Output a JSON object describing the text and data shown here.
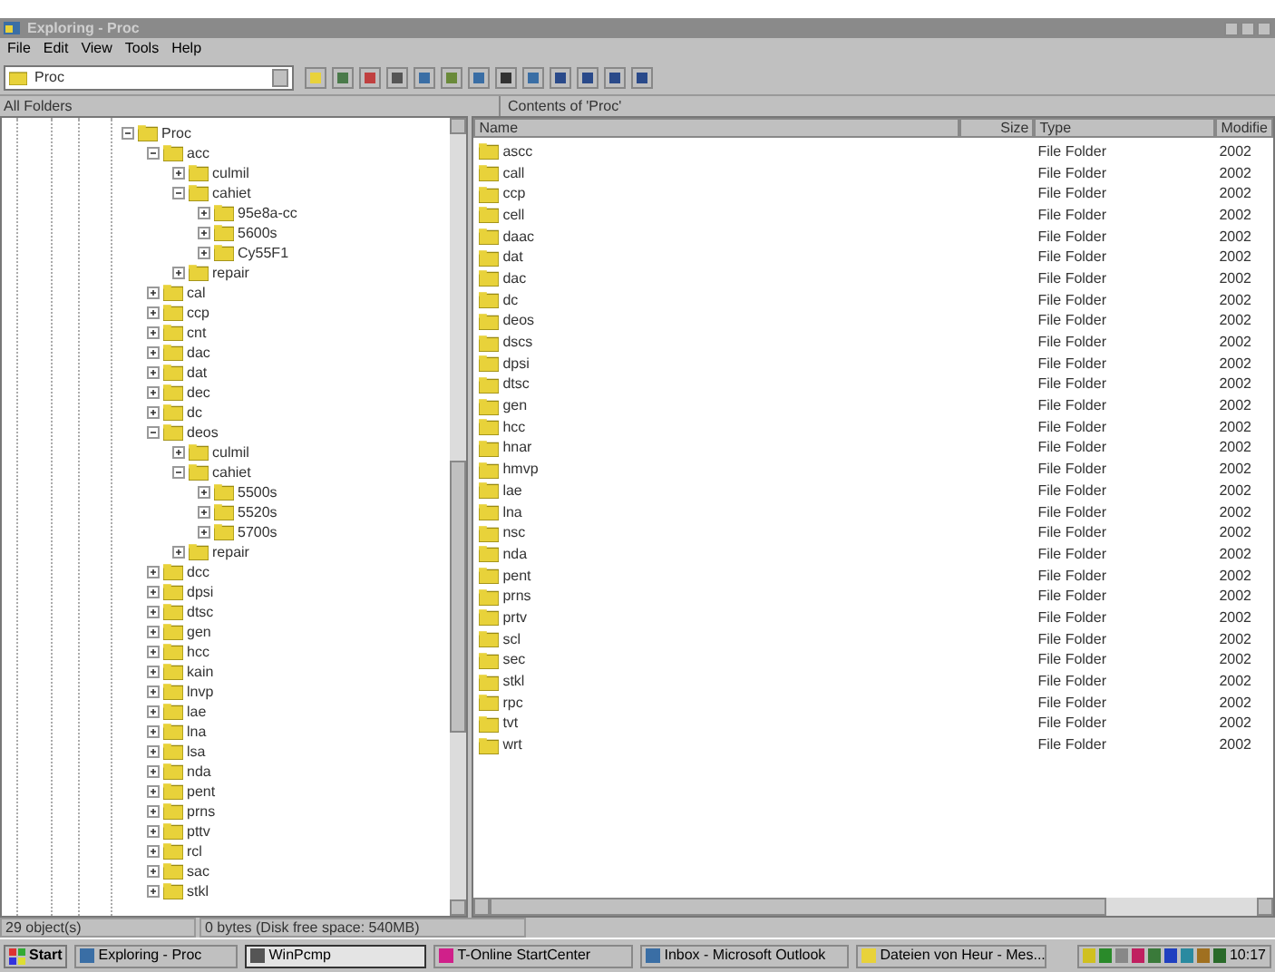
{
  "window": {
    "title": "Exploring - Proc"
  },
  "menu": [
    "File",
    "Edit",
    "View",
    "Tools",
    "Help"
  ],
  "address": {
    "value": "Proc"
  },
  "tree_header": "All Folders",
  "list_header": "Contents of 'Proc'",
  "tree": [
    {
      "label": "Proc",
      "expanded": true,
      "children": [
        {
          "label": "acc",
          "expanded": true,
          "children": [
            {
              "label": "culmil",
              "expanded": false
            },
            {
              "label": "cahiet",
              "expanded": true,
              "children": [
                {
                  "label": "95e8a-cc",
                  "expanded": false
                },
                {
                  "label": "5600s",
                  "expanded": false
                },
                {
                  "label": "Cy55F1",
                  "expanded": false
                }
              ]
            },
            {
              "label": "repair",
              "expanded": false
            }
          ]
        },
        {
          "label": "cal",
          "expanded": false
        },
        {
          "label": "ccp",
          "expanded": false
        },
        {
          "label": "cnt",
          "expanded": false
        },
        {
          "label": "dac",
          "expanded": false
        },
        {
          "label": "dat",
          "expanded": false
        },
        {
          "label": "dec",
          "expanded": false
        },
        {
          "label": "dc",
          "expanded": false
        },
        {
          "label": "deos",
          "expanded": true,
          "children": [
            {
              "label": "culmil",
              "expanded": false
            },
            {
              "label": "cahiet",
              "expanded": true,
              "children": [
                {
                  "label": "5500s",
                  "expanded": false
                },
                {
                  "label": "5520s",
                  "expanded": false
                },
                {
                  "label": "5700s",
                  "expanded": false
                }
              ]
            },
            {
              "label": "repair",
              "expanded": false
            }
          ]
        },
        {
          "label": "dcc",
          "expanded": false
        },
        {
          "label": "dpsi",
          "expanded": false
        },
        {
          "label": "dtsc",
          "expanded": false
        },
        {
          "label": "gen",
          "expanded": false
        },
        {
          "label": "hcc",
          "expanded": false
        },
        {
          "label": "kain",
          "expanded": false
        },
        {
          "label": "lnvp",
          "expanded": false
        },
        {
          "label": "lae",
          "expanded": false
        },
        {
          "label": "lna",
          "expanded": false
        },
        {
          "label": "lsa",
          "expanded": false
        },
        {
          "label": "nda",
          "expanded": false
        },
        {
          "label": "pent",
          "expanded": false
        },
        {
          "label": "prns",
          "expanded": false
        },
        {
          "label": "pttv",
          "expanded": false
        },
        {
          "label": "rcl",
          "expanded": false
        },
        {
          "label": "sac",
          "expanded": false
        },
        {
          "label": "stkl",
          "expanded": false
        }
      ]
    }
  ],
  "list": {
    "columns": [
      "Name",
      "Size",
      "Type",
      "Modifie"
    ],
    "rows": [
      [
        "ascc",
        "",
        "File Folder",
        "2002"
      ],
      [
        "call",
        "",
        "File Folder",
        "2002"
      ],
      [
        "ccp",
        "",
        "File Folder",
        "2002"
      ],
      [
        "cell",
        "",
        "File Folder",
        "2002"
      ],
      [
        "daac",
        "",
        "File Folder",
        "2002"
      ],
      [
        "dat",
        "",
        "File Folder",
        "2002"
      ],
      [
        "dac",
        "",
        "File Folder",
        "2002"
      ],
      [
        "dc",
        "",
        "File Folder",
        "2002"
      ],
      [
        "deos",
        "",
        "File Folder",
        "2002"
      ],
      [
        "dscs",
        "",
        "File Folder",
        "2002"
      ],
      [
        "dpsi",
        "",
        "File Folder",
        "2002"
      ],
      [
        "dtsc",
        "",
        "File Folder",
        "2002"
      ],
      [
        "gen",
        "",
        "File Folder",
        "2002"
      ],
      [
        "hcc",
        "",
        "File Folder",
        "2002"
      ],
      [
        "hnar",
        "",
        "File Folder",
        "2002"
      ],
      [
        "hmvp",
        "",
        "File Folder",
        "2002"
      ],
      [
        "lae",
        "",
        "File Folder",
        "2002"
      ],
      [
        "lna",
        "",
        "File Folder",
        "2002"
      ],
      [
        "nsc",
        "",
        "File Folder",
        "2002"
      ],
      [
        "nda",
        "",
        "File Folder",
        "2002"
      ],
      [
        "pent",
        "",
        "File Folder",
        "2002"
      ],
      [
        "prns",
        "",
        "File Folder",
        "2002"
      ],
      [
        "prtv",
        "",
        "File Folder",
        "2002"
      ],
      [
        "scl",
        "",
        "File Folder",
        "2002"
      ],
      [
        "sec",
        "",
        "File Folder",
        "2002"
      ],
      [
        "stkl",
        "",
        "File Folder",
        "2002"
      ],
      [
        "rpc",
        "",
        "File Folder",
        "2002"
      ],
      [
        "tvt",
        "",
        "File Folder",
        "2002"
      ],
      [
        "wrt",
        "",
        "File Folder",
        "2002"
      ]
    ]
  },
  "status_bar": [
    "29 object(s)",
    "0 bytes (Disk free space: 540MB)"
  ],
  "taskbar": {
    "start": "Start",
    "tasks": [
      {
        "label": "Exploring - Proc",
        "selected": false
      },
      {
        "label": "WinPcmp",
        "selected": true
      },
      {
        "label": "T-Online StartCenter",
        "selected": false
      },
      {
        "label": "Inbox - Microsoft Outlook",
        "selected": false
      },
      {
        "label": "Dateien von Heur - Mes...",
        "selected": false
      }
    ],
    "clock": "10:17"
  }
}
